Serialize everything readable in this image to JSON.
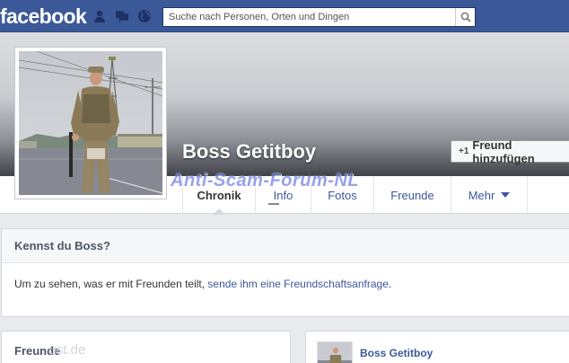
{
  "topbar": {
    "logo": "facebook",
    "search_placeholder": "Suche nach Personen, Orten und Dingen"
  },
  "profile": {
    "name": "Boss Getitboy",
    "add_friend_plus": "+1",
    "add_friend_label": "Freund hinzufügen"
  },
  "watermark": "Anti-Scam-Forum-NL",
  "nav": {
    "tabs": [
      {
        "label": "Chronik"
      },
      {
        "label": "Info"
      },
      {
        "label": "Fotos"
      },
      {
        "label": "Freunde"
      },
      {
        "label": "Mehr"
      }
    ]
  },
  "know_box": {
    "title": "Kennst du Boss?",
    "text": "Um zu sehen, was er mit Freunden teilt, ",
    "link": "sende ihm eine Freundschaftsanfrage",
    "end": "."
  },
  "friends_box": {
    "title": "Freunde",
    "dot": "·",
    "watermark": "...ust.de"
  },
  "post_box": {
    "name": "Boss Getitboy"
  },
  "colors": {
    "brand": "#3b5998",
    "link": "#3b5998",
    "watermark": "#7583e6"
  }
}
